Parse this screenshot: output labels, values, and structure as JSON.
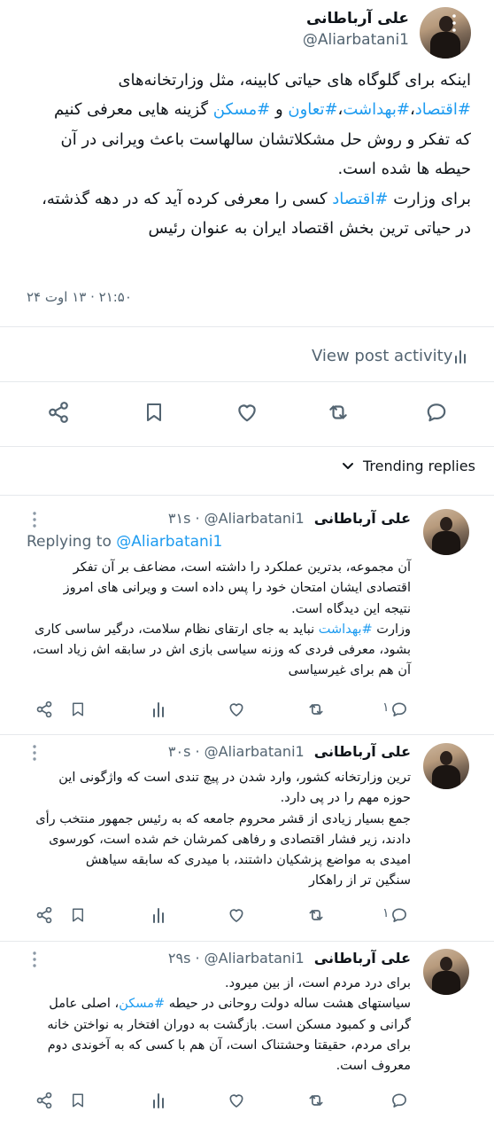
{
  "main_post": {
    "author_name": "علی آرباطانی",
    "handle": "@Aliarbatani1",
    "body_lines": [
      [
        {
          "t": "اینکه برای گلوگاه های حیاتی کابینه، مثل وزارتخانه‌های"
        }
      ],
      [
        {
          "t": "#اقتصاد",
          "h": true
        },
        {
          "t": "،"
        },
        {
          "t": "#بهداشت",
          "h": true
        },
        {
          "t": "،"
        },
        {
          "t": "#تعاون",
          "h": true
        },
        {
          "t": " و "
        },
        {
          "t": "#مسکن",
          "h": true
        },
        {
          "t": " گزینه هایی معرفی کنیم"
        }
      ],
      [
        {
          "t": "که تفکر و روش حل مشکلاتشان سالهاست باعث ویرانی در آن"
        }
      ],
      [
        {
          "t": "حیطه ها شده است."
        }
      ],
      [
        {
          "t": "برای وزارت "
        },
        {
          "t": "#اقتصاد",
          "h": true
        },
        {
          "t": " کسی را معرفی کرده آید که در دهه گذشته،"
        }
      ],
      [
        {
          "t": "در حیاتی ترین بخش اقتصاد ایران به عنوان رئیس"
        }
      ]
    ],
    "timestamp": "۲۱:۵۰ · ۱۳ اوت ۲۴",
    "view_activity": "View post activity"
  },
  "trending_label": "Trending replies",
  "replies": [
    {
      "author_name": "علی آرباطانی",
      "handle": "@Aliarbatani1",
      "time": "۳۱s",
      "replying_prefix": "Replying to",
      "replying_handle": "@Aliarbatani1",
      "lines": [
        [
          {
            "t": "آن مجموعه، بدترین عملکرد را داشته است، مضاعف بر آن تفکر"
          }
        ],
        [
          {
            "t": "اقتصادی ایشان امتحان خود را پس داده است و ویرانی های امروز"
          }
        ],
        [
          {
            "t": "نتیجه این دیدگاه است."
          }
        ],
        [
          {
            "t": "وزارت "
          },
          {
            "t": "#بهداشت",
            "h": true
          },
          {
            "t": " نباید به جای ارتقای نظام سلامت، درگیر ساسی کاری"
          }
        ],
        [
          {
            "t": "بشود، معرفی فردی که وزنه سیاسی بازی اش در سابقه اش زیاد است،"
          }
        ],
        [
          {
            "t": "آن هم برای غیرسیاسی"
          }
        ]
      ],
      "reply_count": "۱"
    },
    {
      "author_name": "علی آرباطانی",
      "handle": "@Aliarbatani1",
      "time": "۳۰s",
      "lines": [
        [
          {
            "t": "ترین وزارتخانه کشور، وارد شدن در پیچ تندی است که واژگونی این"
          }
        ],
        [
          {
            "t": "حوزه مهم را در پی دارد."
          }
        ],
        [
          {
            "t": "جمع بسیار زیادی از قشر محروم جامعه که به رئیس جمهور منتخب رأی"
          }
        ],
        [
          {
            "t": "دادند، زیر فشار اقتصادی و رفاهی کمرشان خم شده است، کورسوی"
          }
        ],
        [
          {
            "t": "امیدی به مواضع پزشکیان داشتند، با میدری که سابقه سیاهش"
          }
        ],
        [
          {
            "t": "سنگین تر از راهکار"
          }
        ]
      ],
      "reply_count": "۱"
    },
    {
      "author_name": "علی آرباطانی",
      "handle": "@Aliarbatani1",
      "time": "۲۹s",
      "lines": [
        [
          {
            "t": "برای درد مردم است، از بین میرود."
          }
        ],
        [
          {
            "t": "سیاستهای هشت ساله دولت روحانی در حیطه "
          },
          {
            "t": "#مسکن",
            "h": true
          },
          {
            "t": "، اصلی عامل"
          }
        ],
        [
          {
            "t": "گرانی و کمبود مسکن است. بازگشت به دوران افتخار به نواختن خانه"
          }
        ],
        [
          {
            "t": "برای مردم، حقیقتا وحشتناک است، آن هم با کسی که به آخوندی دوم"
          }
        ],
        [
          {
            "t": "معروف است."
          }
        ]
      ],
      "reply_count": ""
    }
  ],
  "icons": {
    "more": "more-vertical-icon",
    "share": "share-icon",
    "bookmark": "bookmark-icon",
    "like": "heart-icon",
    "retweet": "retweet-icon",
    "reply": "reply-icon",
    "stats": "bar-chart-icon",
    "chevron": "chevron-down-icon"
  },
  "colors": {
    "link": "#1d9bf0",
    "text": "#0f1419",
    "muted": "#536471"
  }
}
